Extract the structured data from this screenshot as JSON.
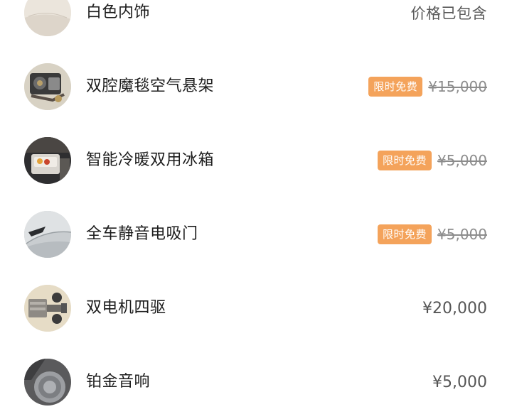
{
  "items": [
    {
      "name": "白色内饰",
      "image_icon": "white-interior-swatch",
      "included_text": "价格已包含"
    },
    {
      "name": "双腔魔毯空气悬架",
      "image_icon": "air-suspension-part",
      "badge": "限时免费",
      "original_price": "¥15,000"
    },
    {
      "name": "智能冷暖双用冰箱",
      "image_icon": "car-fridge",
      "badge": "限时免费",
      "original_price": "¥5,000"
    },
    {
      "name": "全车静音电吸门",
      "image_icon": "soft-close-door",
      "badge": "限时免费",
      "original_price": "¥5,000"
    },
    {
      "name": "双电机四驱",
      "image_icon": "dual-motor-chassis",
      "price": "¥20,000"
    },
    {
      "name": "铂金音响",
      "image_icon": "speaker-grille",
      "price": "¥5,000"
    }
  ],
  "colors": {
    "badge_background": "#f4a35b",
    "badge_text": "#ffffff",
    "struck_price": "#8c8c8c",
    "price": "#555555"
  }
}
